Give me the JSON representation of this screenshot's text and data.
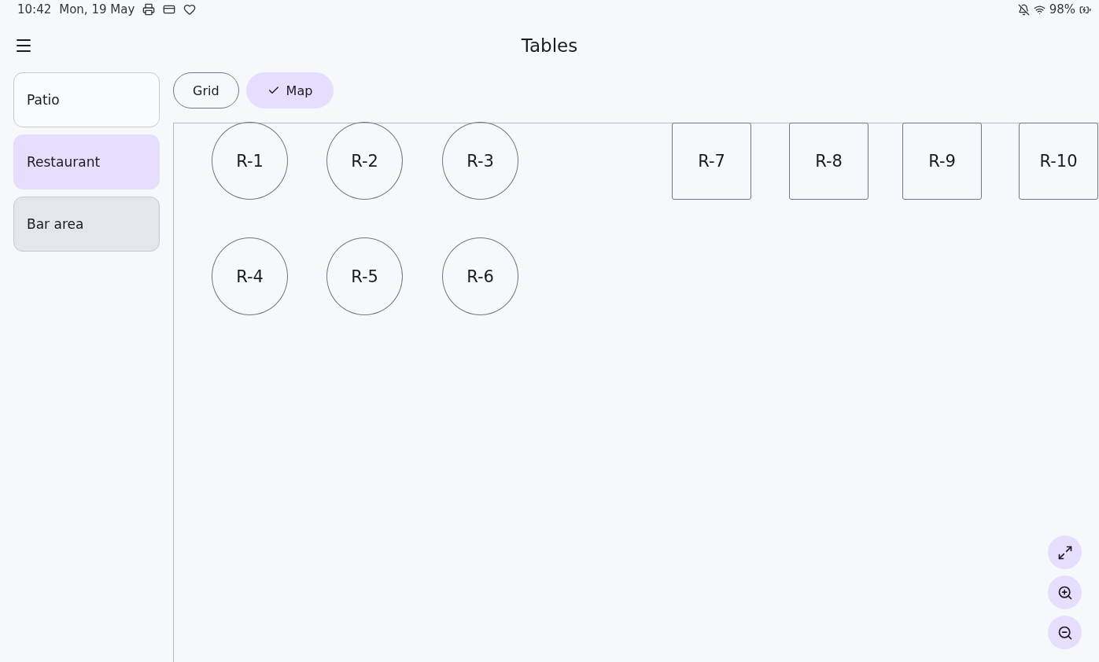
{
  "status_bar": {
    "time": "10:42",
    "date": "Mon, 19 May",
    "battery": "98%"
  },
  "app_bar": {
    "title": "Tables"
  },
  "areas": [
    {
      "label": "Patio",
      "selected": false,
      "highlighted": false
    },
    {
      "label": "Restaurant",
      "selected": true,
      "highlighted": false
    },
    {
      "label": "Bar area",
      "selected": false,
      "highlighted": true
    }
  ],
  "view_modes": [
    {
      "label": "Grid",
      "selected": false
    },
    {
      "label": "Map",
      "selected": true
    }
  ],
  "tables": [
    {
      "label": "R-1",
      "kind": "round"
    },
    {
      "label": "R-2",
      "kind": "round"
    },
    {
      "label": "R-3",
      "kind": "round"
    },
    {
      "label": "R-7",
      "kind": "square"
    },
    {
      "label": "R-8",
      "kind": "square"
    },
    {
      "label": "R-9",
      "kind": "square"
    },
    {
      "label": "R-10",
      "kind": "square"
    },
    {
      "label": "R-4",
      "kind": "round"
    },
    {
      "label": "R-5",
      "kind": "round"
    },
    {
      "label": "R-6",
      "kind": "round"
    }
  ]
}
